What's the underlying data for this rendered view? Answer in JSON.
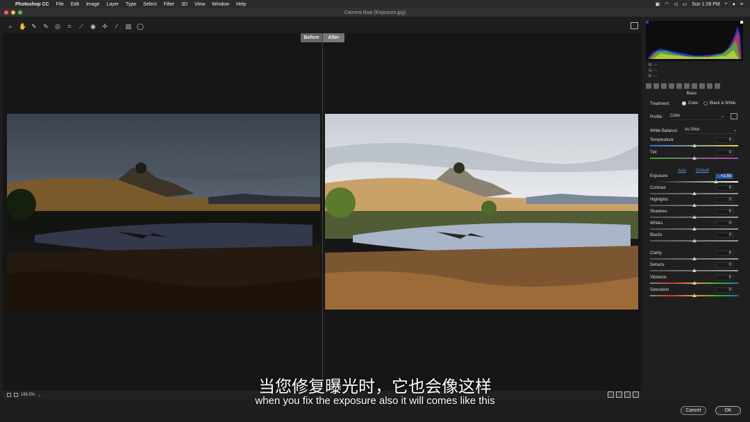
{
  "menubar": {
    "app": "Photoshop CC",
    "items": [
      "File",
      "Edit",
      "Image",
      "Layer",
      "Type",
      "Select",
      "Filter",
      "3D",
      "View",
      "Window",
      "Help"
    ],
    "clock": "Sun 1:28 PM"
  },
  "window": {
    "title": "Camera Raw (Exposure.jpg)"
  },
  "compare": {
    "before": "Before",
    "after": "After"
  },
  "zoom": {
    "level": "166.5%"
  },
  "panel": {
    "rgb": {
      "r": "R:   ---",
      "g": "G:   ---",
      "b": "B:   ---"
    },
    "title": "Basic",
    "treatment_label": "Treatment:",
    "treatment_color": "Color",
    "treatment_bw": "Black & White",
    "profile_label": "Profile:",
    "profile_value": "Color",
    "wb_label": "White Balance:",
    "wb_value": "As Shot",
    "auto": "Auto",
    "default": "Default",
    "sliders": [
      {
        "label": "Temperature",
        "value": "0",
        "pos": 0.5
      },
      {
        "label": "Tint",
        "value": "0",
        "pos": 0.5
      },
      {
        "label": "Exposure",
        "value": "+2.55",
        "pos": 0.75
      },
      {
        "label": "Contrast",
        "value": "0",
        "pos": 0.5
      },
      {
        "label": "Highlights",
        "value": "0",
        "pos": 0.5
      },
      {
        "label": "Shadows",
        "value": "0",
        "pos": 0.5
      },
      {
        "label": "Whites",
        "value": "0",
        "pos": 0.5
      },
      {
        "label": "Blacks",
        "value": "0",
        "pos": 0.5
      },
      {
        "label": "Clarity",
        "value": "0",
        "pos": 0.5
      },
      {
        "label": "Dehaze",
        "value": "0",
        "pos": 0.5
      },
      {
        "label": "Vibrance",
        "value": "0",
        "pos": 0.5
      },
      {
        "label": "Saturation",
        "value": "0",
        "pos": 0.5
      }
    ]
  },
  "buttons": {
    "cancel": "Cancel",
    "ok": "OK"
  },
  "subtitles": {
    "cn": "当您修复曝光时，它也会像这样",
    "en": "when you fix the exposure also it will comes like this"
  },
  "colors": {
    "accent": "#1d6fe0",
    "exposure_field": "#2a5fb5"
  }
}
